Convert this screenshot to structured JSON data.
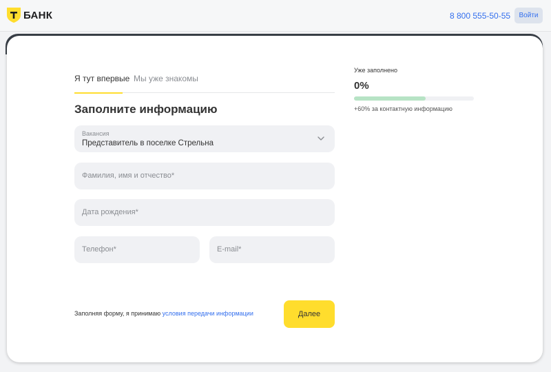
{
  "header": {
    "logo_text": "БАНК",
    "phone": "8 800 555-50-55",
    "login_label": "Войти"
  },
  "tabs": [
    {
      "label": "Я тут впервые",
      "active": true
    },
    {
      "label": "Мы уже знакомы",
      "active": false
    }
  ],
  "form": {
    "title": "Заполните информацию",
    "vacancy": {
      "label": "Вакансия",
      "value": "Представитель в поселке Стрельна"
    },
    "full_name": {
      "placeholder": "Фамилия, имя и отчество*"
    },
    "birth_date": {
      "placeholder": "Дата рождения*"
    },
    "phone": {
      "placeholder": "Телефон*"
    },
    "email": {
      "placeholder": "E-mail*"
    },
    "consent_text": "Заполняя форму, я принимаю",
    "consent_link": "условия передачи информации",
    "submit_label": "Далее"
  },
  "progress": {
    "label": "Уже заполнено",
    "value_text": "0%",
    "potential_fraction": 0.6,
    "note": "+60% за контактную информацию"
  },
  "colors": {
    "brand_yellow": "#ffdd2d",
    "link_blue": "#336fee",
    "progress_green": "#b7e3c5"
  },
  "icons": {
    "logo": "bank-shield-logo-icon",
    "dropdown": "chevron-down-icon"
  }
}
